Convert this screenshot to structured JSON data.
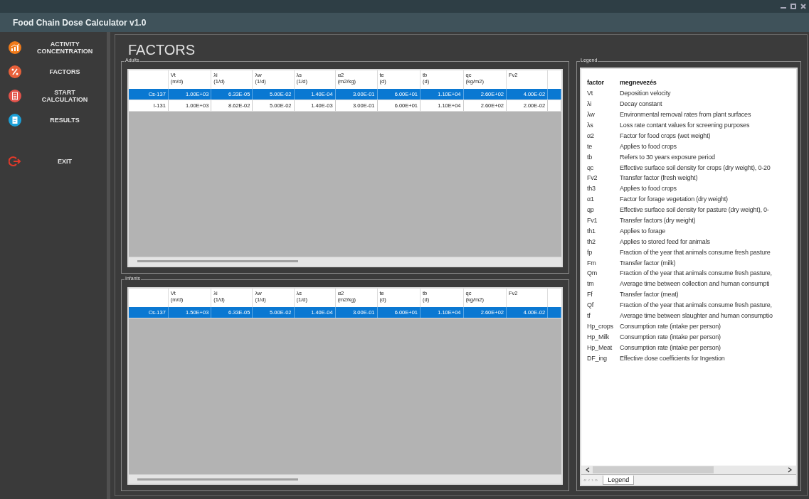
{
  "window": {
    "title": "Food Chain Dose Calculator v1.0"
  },
  "sidebar": {
    "items": [
      {
        "label": "ACTIVITY CONCENTRATION",
        "kind": "chart"
      },
      {
        "label": "FACTORS",
        "kind": "factors"
      },
      {
        "label": "START CALCULATION",
        "kind": "calc"
      },
      {
        "label": "RESULTS",
        "kind": "results"
      },
      {
        "label": "EXIT",
        "kind": "exit"
      }
    ]
  },
  "page_title": "FACTORS",
  "groups": [
    {
      "title": "Adults",
      "columns": [
        {},
        {
          "name": "Vt",
          "unit": "(m/d)"
        },
        {
          "name": "λi",
          "unit": "(1/d)"
        },
        {
          "name": "λw",
          "unit": "(1/d)"
        },
        {
          "name": "λs",
          "unit": "(1/d)"
        },
        {
          "name": "α2",
          "unit": "(m2/kg)"
        },
        {
          "name": "te",
          "unit": "(d)"
        },
        {
          "name": "tb",
          "unit": "(d)"
        },
        {
          "name": "qc",
          "unit": "(kg/m2)"
        },
        {
          "name": "Fv2"
        }
      ],
      "rows": [
        {
          "selected": true,
          "cells": [
            "Cs-137",
            "1.00E+03",
            "6.33E-05",
            "5.00E-02",
            "1.40E-04",
            "3.00E-01",
            "6.00E+01",
            "1.10E+04",
            "2.60E+02",
            "4.00E-02"
          ]
        },
        {
          "selected": false,
          "cells": [
            "I-131",
            "1.00E+03",
            "8.62E-02",
            "5.00E-02",
            "1.40E-03",
            "3.00E-01",
            "6.00E+01",
            "1.10E+04",
            "2.60E+02",
            "2.00E-02"
          ]
        }
      ]
    },
    {
      "title": "Infants",
      "columns": [
        {},
        {
          "name": "Vt",
          "unit": "(m/d)"
        },
        {
          "name": "λi",
          "unit": "(1/d)"
        },
        {
          "name": "λw",
          "unit": "(1/d)"
        },
        {
          "name": "λs",
          "unit": "(1/d)"
        },
        {
          "name": "α2",
          "unit": "(m2/kg)"
        },
        {
          "name": "te",
          "unit": "(d)"
        },
        {
          "name": "tb",
          "unit": "(d)"
        },
        {
          "name": "qc",
          "unit": "(kg/m2)"
        },
        {
          "name": "Fv2"
        }
      ],
      "rows": [
        {
          "selected": true,
          "cells": [
            "Cs-137",
            "1.50E+03",
            "6.33E-05",
            "5.00E-02",
            "1.40E-04",
            "3.00E-01",
            "6.00E+01",
            "1.10E+04",
            "2.60E+02",
            "4.00E-02"
          ]
        }
      ]
    }
  ],
  "legend": {
    "title": "Legend",
    "header": [
      "factor",
      "megnevezés"
    ],
    "rows": [
      [
        "Vt",
        "Deposition velocity"
      ],
      [
        "λi",
        "Decay constant"
      ],
      [
        "λw",
        "Environmental removal rates from plant surfaces"
      ],
      [
        "λs",
        "Loss rate contant values for screening purposes"
      ],
      [
        "α2",
        "Factor for food crops (wet weight)"
      ],
      [
        "te",
        "Applies to food crops"
      ],
      [
        "tb",
        "Refers to 30 years exposure period"
      ],
      [
        "qc",
        "Effective surface soil density for crops (dry weight), 0-20"
      ],
      [
        "Fv2",
        "Transfer factor (fresh weight)"
      ],
      [
        "th3",
        "Applies to food crops"
      ],
      [
        "α1",
        "Factor for forage vegetation (dry weight)"
      ],
      [
        "qp",
        "Effective surface soil density for pasture (dry weight), 0-"
      ],
      [
        "Fv1",
        "Transfer factors (dry weight)"
      ],
      [
        "th1",
        "Applies to forage"
      ],
      [
        "th2",
        "Applies to stored feed for animals"
      ],
      [
        "fp",
        "Fraction of the year that animals consume fresh pasture"
      ],
      [
        "Fm",
        "Transfer factor (milk)"
      ],
      [
        "Qm",
        "Fraction of the year that animals consume fresh pasture,"
      ],
      [
        "tm",
        "Average time between collection and human consumpti"
      ],
      [
        "Ff",
        "Transfer factor (meat)"
      ],
      [
        "Qf",
        "Fraction of the year that animals consume fresh pasture,"
      ],
      [
        "tf",
        "Average time between slaughter and human consumptio"
      ],
      [
        "Hp_crops",
        "Consumption rate (intake per person)"
      ],
      [
        "Hp_Milk",
        "Consumption rate (intake per person)"
      ],
      [
        "Hp_Meat",
        "Consumption rate (intake per person)"
      ],
      [
        "DF_ing",
        "Effective dose coefficients for Ingestion"
      ]
    ],
    "nav": [
      "«",
      "‹",
      "›",
      "»"
    ],
    "sheet_tab": "Legend"
  }
}
